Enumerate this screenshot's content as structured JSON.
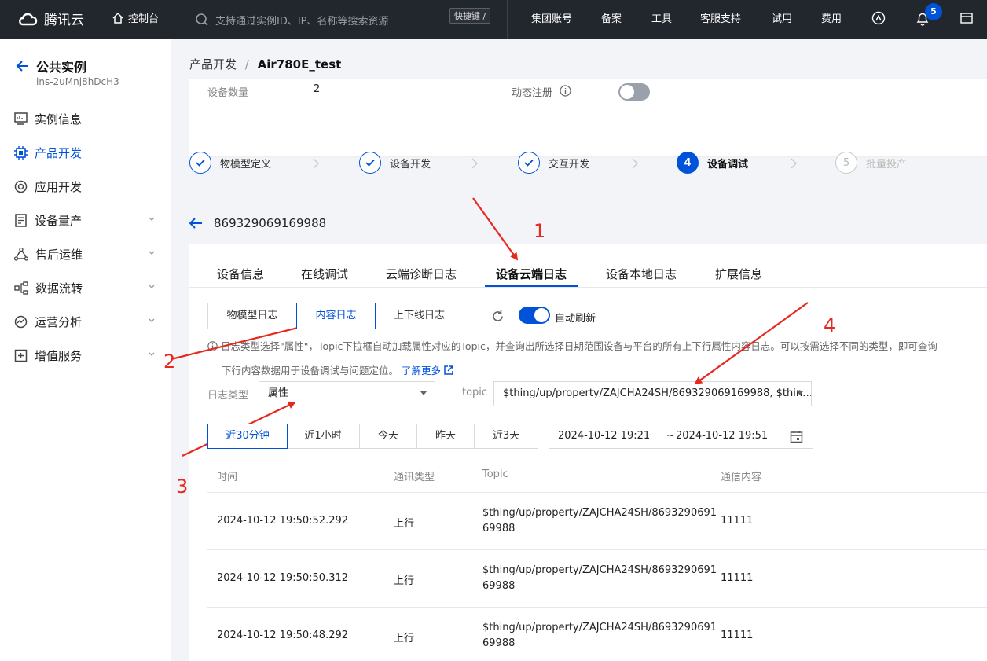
{
  "topbar": {
    "brand": "腾讯云",
    "console": "控制台",
    "search_placeholder": "支持通过实例ID、IP、名称等搜索资源",
    "shortcut": "快捷键 /",
    "links": [
      "集团账号",
      "备案",
      "工具",
      "客服支持",
      "试用",
      "费用"
    ],
    "notification_count": "5"
  },
  "sidebar": {
    "title": "公共实例",
    "instance_id": "ins-2uMnj8hDcH3",
    "items": [
      {
        "label": "实例信息",
        "icon": "monitor-icon"
      },
      {
        "label": "产品开发",
        "icon": "chip-icon"
      },
      {
        "label": "应用开发",
        "icon": "app-dev-icon"
      },
      {
        "label": "设备量产",
        "icon": "device-batch-icon"
      },
      {
        "label": "售后运维",
        "icon": "after-sales-icon"
      },
      {
        "label": "数据流转",
        "icon": "data-flow-icon"
      },
      {
        "label": "运营分析",
        "icon": "analytics-icon"
      },
      {
        "label": "增值服务",
        "icon": "value-added-icon"
      }
    ]
  },
  "breadcrumb": {
    "parent": "产品开发",
    "sep": "/",
    "current": "Air780E_test"
  },
  "product_info": {
    "device_count_label": "设备数量",
    "device_count_value": "2",
    "dynamic_reg_label": "动态注册"
  },
  "steps": [
    {
      "label": "物模型定义",
      "num": "",
      "state": "done"
    },
    {
      "label": "设备开发",
      "num": "",
      "state": "done"
    },
    {
      "label": "交互开发",
      "num": "",
      "state": "done"
    },
    {
      "label": "设备调试",
      "num": "4",
      "state": "current"
    },
    {
      "label": "批量投产",
      "num": "5",
      "state": "todo"
    }
  ],
  "device_id": "869329069169988",
  "tabs": [
    "设备信息",
    "在线调试",
    "云端诊断日志",
    "设备云端日志",
    "设备本地日志",
    "扩展信息"
  ],
  "active_tab": "设备云端日志",
  "log_segments": [
    "物模型日志",
    "内容日志",
    "上下线日志"
  ],
  "auto_refresh_label": "自动刷新",
  "tip_line1": "日志类型选择\"属性\"，Topic下拉框自动加载属性对应的Topic，并查询出所选择日期范围设备与平台的所有上下行属性内容日志。可以按需选择不同的类型，即可查询",
  "tip_line2": "下行内容数据用于设备调试与问题定位。",
  "tip_link": "了解更多",
  "filters": {
    "log_type_label": "日志类型",
    "log_type_value": "属性",
    "topic_label": "topic",
    "topic_value": "$thing/up/property/ZAJCHA24SH/869329069169988, $thin…"
  },
  "time_ranges": [
    "近30分钟",
    "近1小时",
    "今天",
    "昨天",
    "近3天"
  ],
  "date_range": {
    "start": "2024-10-12 19:21",
    "sep": "~",
    "end": "2024-10-12 19:51"
  },
  "table": {
    "headers": [
      "时间",
      "通讯类型",
      "Topic",
      "通信内容"
    ],
    "rows": [
      {
        "time": "2024-10-12 19:50:52.292",
        "type": "上行",
        "topic_l1": "$thing/up/property/ZAJCHA24SH/8693290691",
        "topic_l2": "69988",
        "content": "11111"
      },
      {
        "time": "2024-10-12 19:50:50.312",
        "type": "上行",
        "topic_l1": "$thing/up/property/ZAJCHA24SH/8693290691",
        "topic_l2": "69988",
        "content": "11111"
      },
      {
        "time": "2024-10-12 19:50:48.292",
        "type": "上行",
        "topic_l1": "$thing/up/property/ZAJCHA24SH/8693290691",
        "topic_l2": "69988",
        "content": "11111"
      }
    ]
  },
  "annotations": [
    "1",
    "2",
    "3",
    "4"
  ],
  "colors": {
    "accent": "#0052d9",
    "annotation": "#e8281e",
    "topbar": "#22262d"
  }
}
